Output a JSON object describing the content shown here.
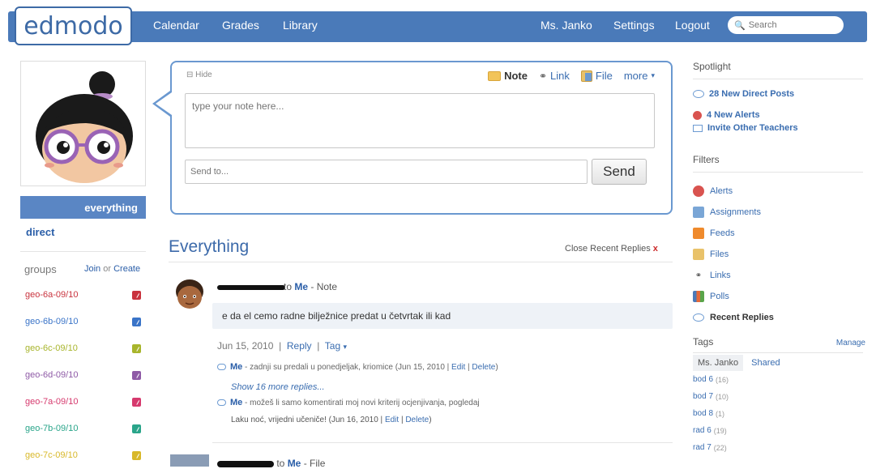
{
  "brand": {
    "logo_text": "edmodo",
    "accent": "#4a7ab9"
  },
  "topnav": {
    "left": [
      "Calendar",
      "Grades",
      "Library"
    ],
    "user": "Ms. Janko",
    "settings": "Settings",
    "logout": "Logout",
    "search_placeholder": "Search"
  },
  "sidebar": {
    "everything": "everything",
    "direct": "direct",
    "groups_title": "groups",
    "join": "Join",
    "or": "or",
    "create": "Create",
    "groups": [
      {
        "name": "geo-6a-09/10",
        "color": "#c9333e"
      },
      {
        "name": "geo-6b-09/10",
        "color": "#3a74c8"
      },
      {
        "name": "geo-6c-09/10",
        "color": "#a8b52c"
      },
      {
        "name": "geo-6d-09/10",
        "color": "#8e5aa6"
      },
      {
        "name": "geo-7a-09/10",
        "color": "#d63a6e"
      },
      {
        "name": "geo-7b-09/10",
        "color": "#2aa58a"
      },
      {
        "name": "geo-7c-09/10",
        "color": "#d8b82a"
      }
    ]
  },
  "composer": {
    "hide": "Hide",
    "types": {
      "note": "Note",
      "link": "Link",
      "file": "File",
      "more": "more"
    },
    "note_placeholder": "type your note here...",
    "send_to_placeholder": "Send to...",
    "send": "Send"
  },
  "feed": {
    "title": "Everything",
    "close_recent_replies": "Close Recent Replies",
    "post1": {
      "recipient": "Me",
      "type": "Note",
      "body": "e da el cemo radne bilježnice predat u četvrtak ili kad",
      "date": "Jun 15, 2010",
      "reply": "Reply",
      "tag": "Tag"
    },
    "reply1": {
      "author": "Me",
      "text": " - zadnji su predali u ponedjeljak, kriomice ",
      "date": "(Jun 15, 2010 | ",
      "edit": "Edit",
      "delete": "Delete"
    },
    "show_more": "Show 16 more replies...",
    "reply2": {
      "author": "Me",
      "text": " - možeš li samo komentirati moj novi kriterij ocjenjivanja, pogledaj",
      "text2": "Laku noć, vrijedni učeniče! ",
      "date": "(Jun 16, 2010 | ",
      "edit": "Edit",
      "delete": "Delete"
    },
    "post2": {
      "recipient": "Me",
      "type": "File"
    }
  },
  "spotlight": {
    "title": "Spotlight",
    "new_direct_posts": "28 New Direct Posts",
    "new_alerts": "4 New Alerts",
    "invite": "Invite Other Teachers"
  },
  "filters": {
    "title": "Filters",
    "items": [
      "Alerts",
      "Assignments",
      "Feeds",
      "Files",
      "Links",
      "Polls",
      "Recent Replies"
    ]
  },
  "tags": {
    "title": "Tags",
    "manage": "Manage",
    "tabs": [
      "Ms. Janko",
      "Shared"
    ],
    "items": [
      {
        "name": "bod 6",
        "count": "(16)"
      },
      {
        "name": "bod 7",
        "count": "(10)"
      },
      {
        "name": "bod 8",
        "count": "(1)"
      },
      {
        "name": "rad 6",
        "count": "(19)"
      },
      {
        "name": "rad 7",
        "count": "(22)"
      }
    ]
  }
}
